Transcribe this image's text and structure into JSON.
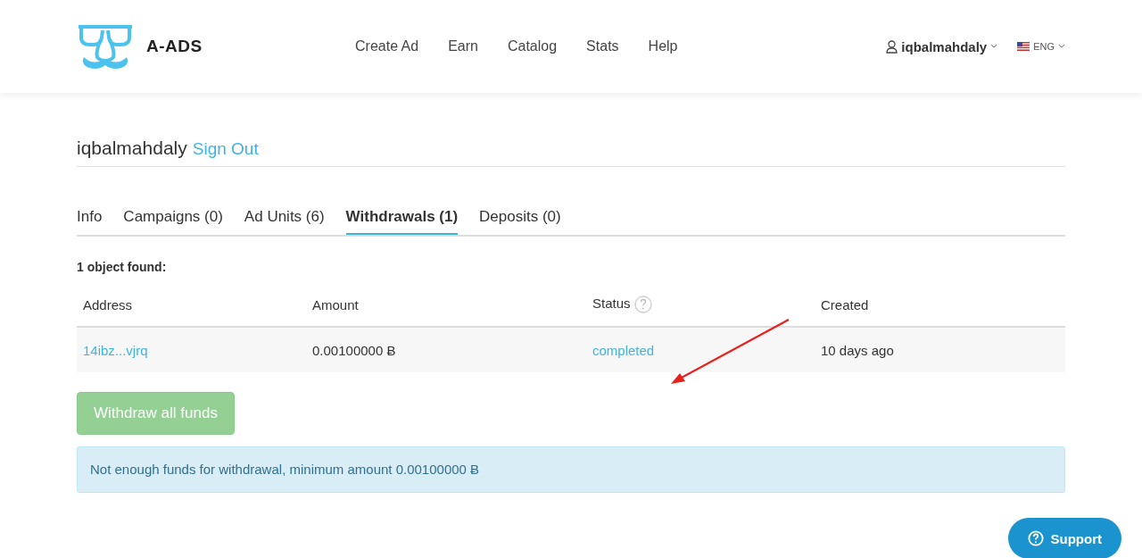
{
  "header": {
    "logo_text": "A-ADS",
    "nav": [
      "Create Ad",
      "Earn",
      "Catalog",
      "Stats",
      "Help"
    ],
    "user": "iqbalmahdaly",
    "language": "ENG"
  },
  "account": {
    "username": "iqbalmahdaly",
    "sign_out": "Sign Out"
  },
  "tabs": [
    {
      "label": "Info",
      "selected": false
    },
    {
      "label": "Campaigns (0)",
      "selected": false
    },
    {
      "label": "Ad Units (6)",
      "selected": false
    },
    {
      "label": "Withdrawals (1)",
      "selected": true
    },
    {
      "label": "Deposits (0)",
      "selected": false
    }
  ],
  "summary": "1 object found:",
  "table": {
    "columns": [
      "Address",
      "Amount",
      "Status",
      "Created"
    ],
    "rows": [
      {
        "address": "14ibz...vjrq",
        "amount": "0.00100000 Ƀ",
        "status": "completed",
        "created": "10 days ago"
      }
    ]
  },
  "withdraw_button": {
    "label": "Withdraw all funds",
    "disabled": true
  },
  "alert": "Not enough funds for withdrawal, minimum amount 0.00100000 Ƀ",
  "support_button": "Support"
}
